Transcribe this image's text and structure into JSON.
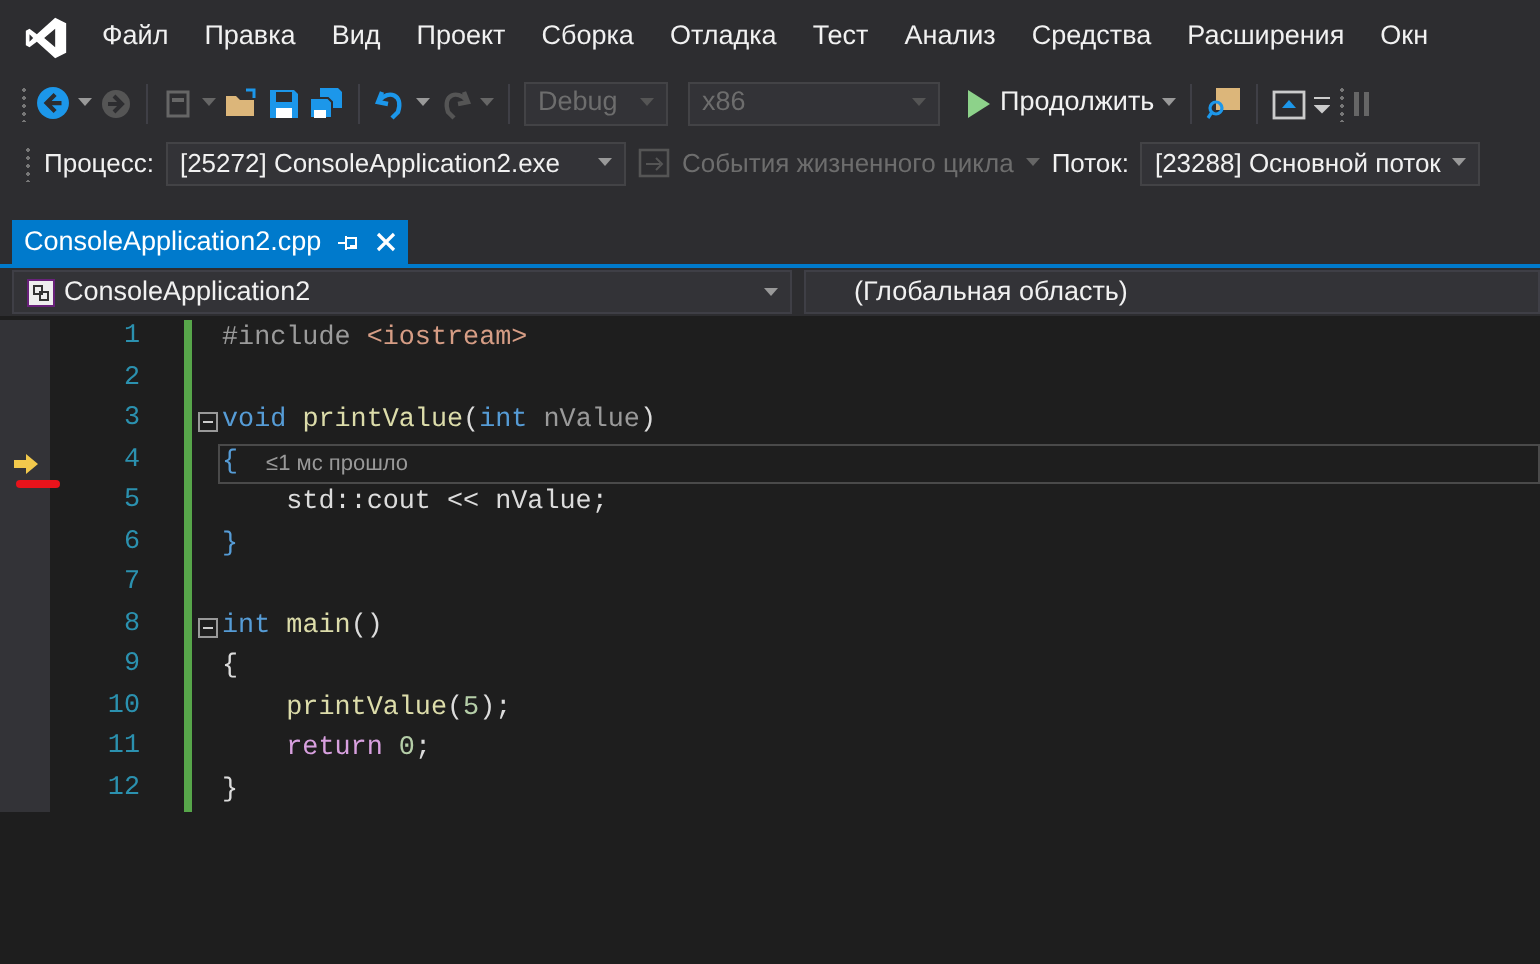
{
  "menu": [
    "Файл",
    "Правка",
    "Вид",
    "Проект",
    "Сборка",
    "Отладка",
    "Тест",
    "Анализ",
    "Средства",
    "Расширения",
    "Окн"
  ],
  "toolbar": {
    "configuration": "Debug",
    "platform": "x86",
    "continue_button": "Продолжить"
  },
  "debug_location": {
    "process_label": "Процесс:",
    "process": "[25272] ConsoleApplication2.exe",
    "lifecycle_events": "События жизненного цикла",
    "thread_label": "Поток:",
    "thread": "[23288] Основной поток"
  },
  "tabs": [
    {
      "label": "ConsoleApplication2.cpp",
      "selected": true
    }
  ],
  "navigation_bar": {
    "project": "ConsoleApplication2",
    "scope": "(Глобальная область)"
  },
  "code_lines": [
    {
      "number": "1",
      "collapsible": false,
      "current": false,
      "tokens": [
        {
          "kind": "preproc",
          "text": "#include "
        },
        {
          "kind": "string",
          "text": "<iostream>"
        }
      ]
    },
    {
      "number": "2",
      "collapsible": false,
      "current": false
    },
    {
      "number": "3",
      "collapsible": true,
      "current": false,
      "tokens": [
        {
          "kind": "keyword",
          "text": "void "
        },
        {
          "kind": "function",
          "text": "printValue"
        },
        {
          "kind": "plain",
          "text": "("
        },
        {
          "kind": "keyword",
          "text": "int "
        },
        {
          "kind": "param",
          "text": "nValue"
        },
        {
          "kind": "plain",
          "text": ")"
        }
      ]
    },
    {
      "number": "4",
      "collapsible": false,
      "current": true,
      "perf_tip": "≤1 мс прошло",
      "tokens": [
        {
          "kind": "brace",
          "text": "{"
        }
      ]
    },
    {
      "number": "5",
      "collapsible": false,
      "current": false,
      "tokens": [
        {
          "kind": "plain",
          "text": "    std::cout << nValue;"
        }
      ]
    },
    {
      "number": "6",
      "collapsible": false,
      "current": false,
      "tokens": [
        {
          "kind": "brace",
          "text": "}"
        }
      ]
    },
    {
      "number": "7",
      "collapsible": false,
      "current": false
    },
    {
      "number": "8",
      "collapsible": true,
      "current": false,
      "tokens": [
        {
          "kind": "keyword",
          "text": "int "
        },
        {
          "kind": "function",
          "text": "main"
        },
        {
          "kind": "plain",
          "text": "()"
        }
      ]
    },
    {
      "number": "9",
      "collapsible": false,
      "current": false,
      "tokens": [
        {
          "kind": "plain",
          "text": "{"
        }
      ]
    },
    {
      "number": "10",
      "collapsible": false,
      "current": false,
      "tokens": [
        {
          "kind": "function",
          "text": "    printValue"
        },
        {
          "kind": "plain",
          "text": "("
        },
        {
          "kind": "number",
          "text": "5"
        },
        {
          "kind": "plain",
          "text": ");"
        }
      ]
    },
    {
      "number": "11",
      "collapsible": false,
      "current": false,
      "tokens": [
        {
          "kind": "control",
          "text": "    return "
        },
        {
          "kind": "number",
          "text": "0"
        },
        {
          "kind": "plain",
          "text": ";"
        }
      ]
    },
    {
      "number": "12",
      "collapsible": false,
      "current": false,
      "tokens": [
        {
          "kind": "plain",
          "text": "}"
        }
      ]
    }
  ]
}
